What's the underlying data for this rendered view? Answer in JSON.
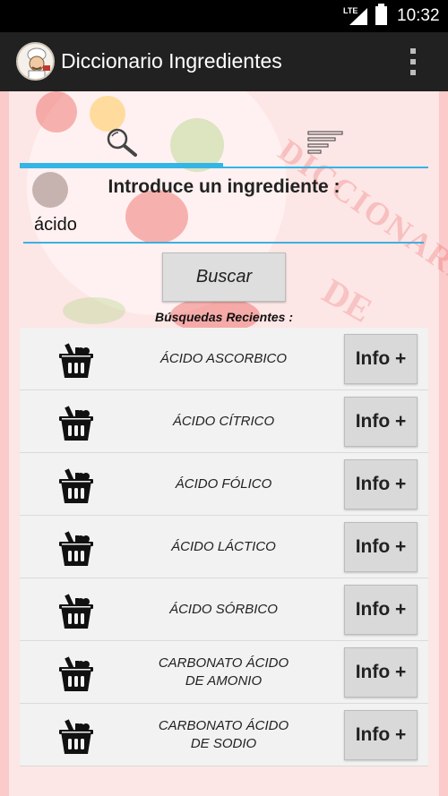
{
  "status_bar": {
    "network": "LTE",
    "time": "10:32"
  },
  "app_bar": {
    "title": "Diccionario Ingredientes"
  },
  "tabs": [
    {
      "name": "search",
      "icon": "search-icon",
      "active": true
    },
    {
      "name": "list",
      "icon": "list-icon",
      "active": false
    }
  ],
  "background": {
    "watermark_line1": "DICCIONARIO",
    "watermark_line2": "DE"
  },
  "search": {
    "prompt": "Introduce un ingrediente :",
    "value": "ácido",
    "button_label": "Buscar"
  },
  "recent": {
    "label": "Búsquedas Recientes :",
    "info_label": "Info +",
    "items": [
      {
        "name": "ÁCIDO ASCORBICO"
      },
      {
        "name": "ÁCIDO CÍTRICO"
      },
      {
        "name": "ÁCIDO FÓLICO"
      },
      {
        "name": "ÁCIDO LÁCTICO"
      },
      {
        "name": "ÁCIDO SÓRBICO"
      },
      {
        "name": "CARBONATO ÁCIDO\nDE AMONIO"
      },
      {
        "name": "CARBONATO ÁCIDO\nDE SODIO"
      }
    ]
  },
  "colors": {
    "accent": "#33b5e5",
    "app_bar": "#212121",
    "background": "#fde6e6"
  }
}
